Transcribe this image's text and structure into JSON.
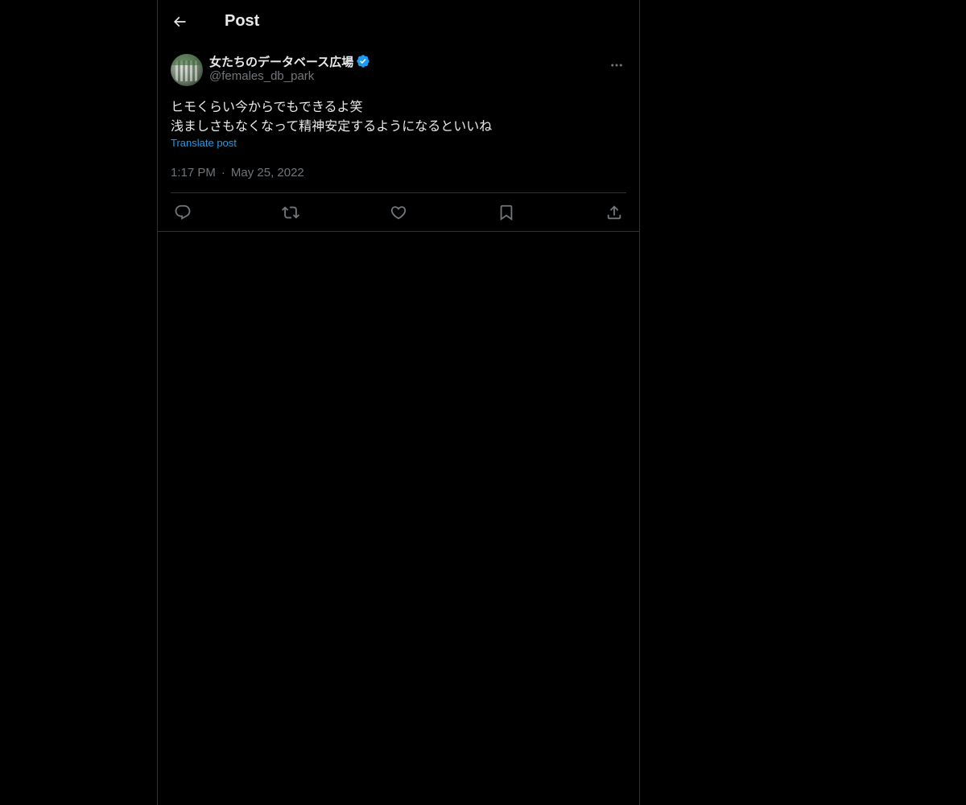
{
  "header": {
    "back_icon": "arrow-left-icon",
    "title": "Post"
  },
  "post": {
    "author": {
      "display_name": "女たちのデータベース広場",
      "handle": "@females_db_park",
      "verified": true,
      "verified_color": "#1d9bf0"
    },
    "text_line_1": "ヒモくらい今からでもできるよ笑",
    "text_line_2": "浅ましさもなくなって精神安定するようになるといいね",
    "translate_label": "Translate post",
    "time": "1:17 PM",
    "separator": "·",
    "date": "May 25, 2022"
  },
  "actions": [
    {
      "icon": "reply-icon"
    },
    {
      "icon": "repost-icon"
    },
    {
      "icon": "like-icon"
    },
    {
      "icon": "bookmark-icon"
    },
    {
      "icon": "share-icon"
    }
  ],
  "colors": {
    "background": "#000000",
    "text": "#e7e9ea",
    "muted": "#71767b",
    "accent": "#1d9bf0",
    "border": "#2f3336"
  }
}
